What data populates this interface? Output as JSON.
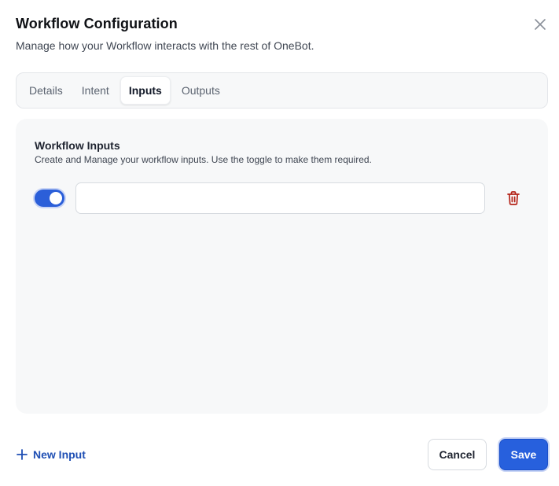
{
  "dialog": {
    "title": "Workflow Configuration",
    "subtitle": "Manage how your Workflow interacts with the rest of OneBot.",
    "close_icon": "close-icon"
  },
  "tabs": [
    {
      "label": "Details",
      "active": false
    },
    {
      "label": "Intent",
      "active": false
    },
    {
      "label": "Inputs",
      "active": true
    },
    {
      "label": "Outputs",
      "active": false
    }
  ],
  "inputs_panel": {
    "title": "Workflow Inputs",
    "description": "Create and Manage your workflow inputs. Use the toggle to make them required.",
    "rows": [
      {
        "required": true,
        "value": "",
        "delete_icon": "trash-icon"
      }
    ]
  },
  "footer": {
    "new_input_label": "New Input",
    "cancel_label": "Cancel",
    "save_label": "Save"
  },
  "colors": {
    "accent": "#2760dd",
    "link": "#1f4fb4",
    "danger": "#b42318",
    "panel_bg": "#f7f8f9"
  }
}
